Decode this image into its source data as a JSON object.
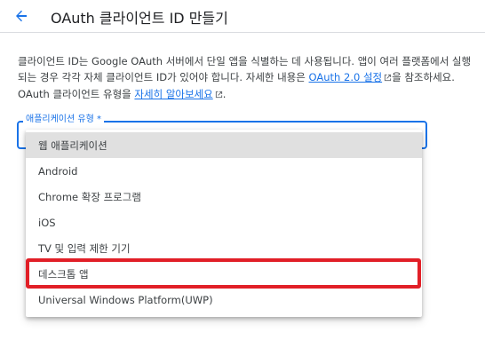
{
  "header": {
    "title": "OAuth 클라이언트 ID 만들기",
    "back_icon": "arrow-left-icon"
  },
  "description": {
    "line1": "클라이언트 ID는 Google OAuth 서버에서 단일 앱을 식별하는 데 사용됩니다. 앱이 여러 플",
    "line2_pre": "랫폼에서 실행되는 경우 각각 자체 클라이언트 ID가 있어야 합니다. 자세한 내용은 ",
    "link1": "OAuth 2.0 설정",
    "line3_mid": "을 참조하세요. OAuth 클라이언트 유형을 ",
    "link2": "자세히 알아보세요",
    "line3_end": "."
  },
  "select": {
    "label": "애플리케이션 유형 *"
  },
  "dropdown": {
    "options": [
      "웹 애플리케이션",
      "Android",
      "Chrome 확장 프로그램",
      "iOS",
      "TV 및 입력 제한 기기",
      "데스크톱 앱",
      "Universal Windows Platform(UWP)"
    ],
    "hovered_index": 0,
    "highlighted_index": 5
  },
  "colors": {
    "accent": "#1a73e8",
    "highlight": "#e11f27",
    "hover_bg": "#e0e0e0"
  }
}
